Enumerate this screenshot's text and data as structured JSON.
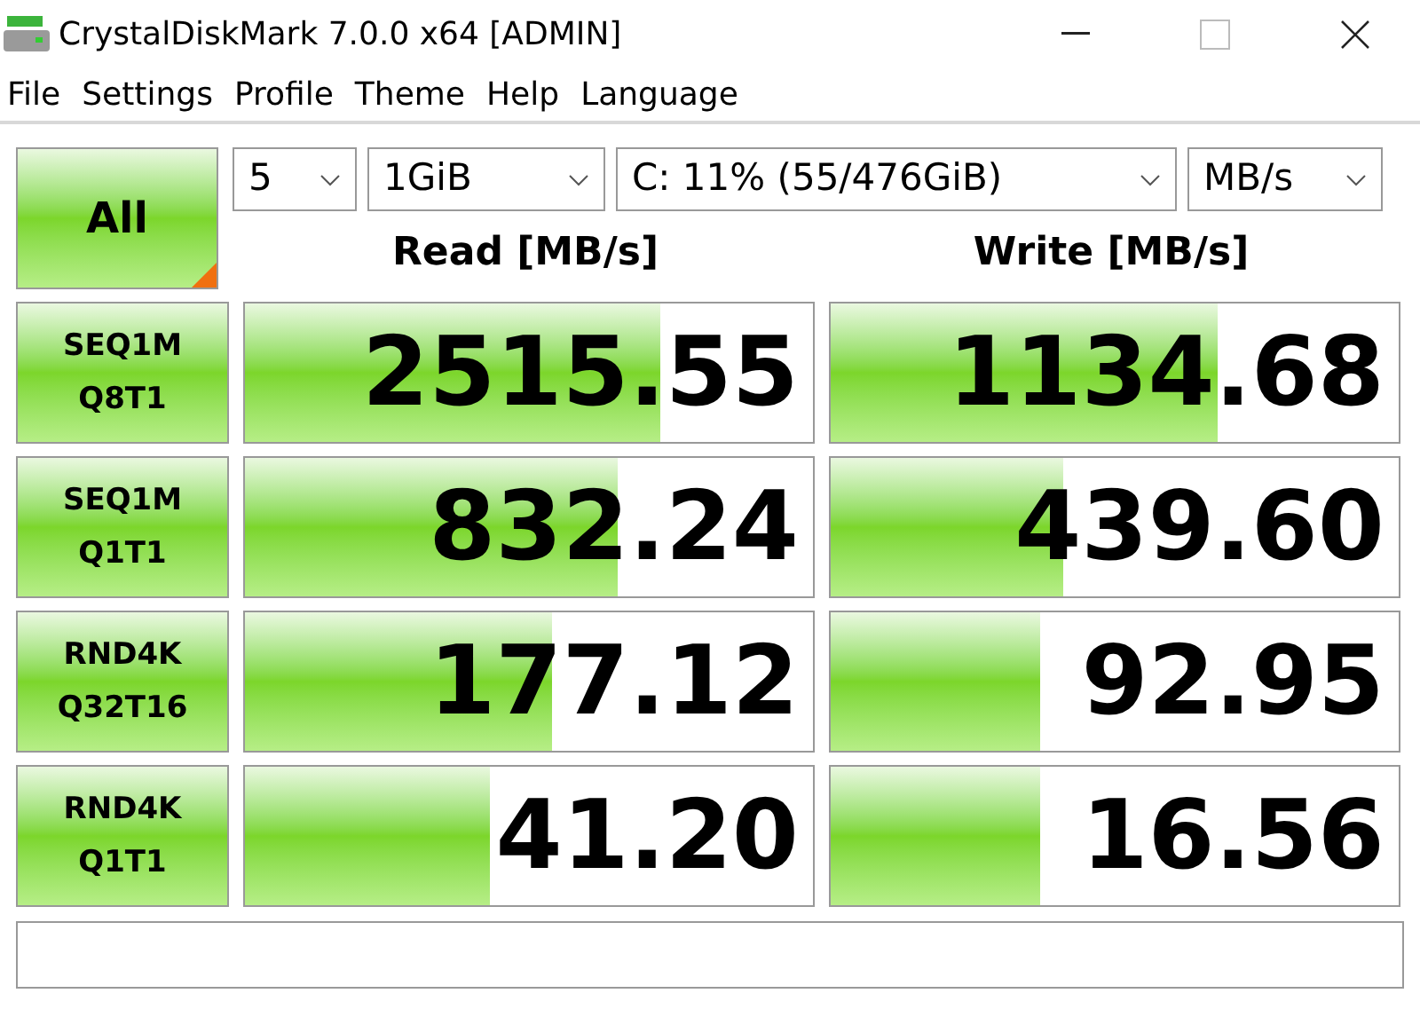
{
  "window": {
    "title": "CrystalDiskMark 7.0.0 x64 [ADMIN]"
  },
  "menu": [
    "File",
    "Settings",
    "Profile",
    "Theme",
    "Help",
    "Language"
  ],
  "all_button": {
    "label": "All"
  },
  "selects": [
    {
      "value": "5"
    },
    {
      "value": "1GiB"
    },
    {
      "value": "C: 11% (55/476GiB)"
    },
    {
      "value": "MB/s"
    }
  ],
  "columns": [
    "Read [MB/s]",
    "Write [MB/s]"
  ],
  "rows": [
    {
      "test": [
        "SEQ1M",
        "Q8T1"
      ],
      "read": {
        "value": "2515.55",
        "level": 0.73
      },
      "write": {
        "value": "1134.68",
        "level": 0.68
      }
    },
    {
      "test": [
        "SEQ1M",
        "Q1T1"
      ],
      "read": {
        "value": "832.24",
        "level": 0.655
      },
      "write": {
        "value": "439.60",
        "level": 0.41
      }
    },
    {
      "test": [
        "RND4K",
        "Q32T16"
      ],
      "read": {
        "value": "177.12",
        "level": 0.54
      },
      "write": {
        "value": "92.95",
        "level": 0.37
      }
    },
    {
      "test": [
        "RND4K",
        "Q1T1"
      ],
      "read": {
        "value": "41.20",
        "level": 0.43
      },
      "write": {
        "value": "16.56",
        "level": 0.37
      }
    }
  ]
}
